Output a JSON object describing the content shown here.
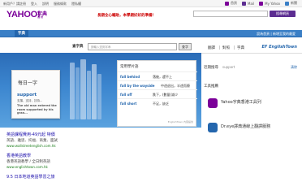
{
  "topbar": {
    "links": [
      "新用戶？請註冊",
      "登入",
      "說明",
      "服務條款",
      "隱私權"
    ],
    "right_items": [
      {
        "label": "首頁",
        "icon": "home-icon",
        "color": "#7b0099"
      },
      {
        "label": "Mail",
        "icon": "mail-icon",
        "color": "#5c2d91"
      },
      {
        "label": "My Yahoo",
        "icon": "yahoo-icon",
        "color": "#7b0099"
      },
      {
        "label": "新聞",
        "icon": "news-icon",
        "color": "#3a7fc6"
      }
    ]
  },
  "header": {
    "logo": "YAHOO!",
    "product": "字典",
    "product_sub": "香港",
    "promo": "長期全心輔助，本學期好好的準備！",
    "search_button": "搜尋網頁",
    "accent": "#7b0099"
  },
  "tabbar": {
    "active_tab": "字典",
    "right_link": "設為首頁 | 新增至我的最愛"
  },
  "search": {
    "label": "查字典",
    "placeholder": "請輸入查詢字串",
    "button": "查字"
  },
  "translate_bar": {
    "items": [
      "翻譯",
      "對照",
      "字典"
    ],
    "brand": "EF EnglishTown"
  },
  "word_of_day": {
    "title": "每日一字",
    "word": "support",
    "meaning": "支撐，支持，扶持...",
    "example": "The old man entered the room supported by his gran..."
  },
  "phrases": {
    "title": "常用學片語",
    "rows": [
      {
        "en": "fall behind",
        "zh": "落後，趕不上"
      },
      {
        "en": "fall by the wayside",
        "zh": "中途退出，半途而廢"
      },
      {
        "en": "fall off",
        "zh": "跌下，(數量)減少"
      },
      {
        "en": "fall short",
        "zh": "不足，缺乏"
      }
    ],
    "credit": "EnglishTown 內容提供"
  },
  "recent": {
    "label": "近期搜尋",
    "value": "support",
    "link": "清除"
  },
  "tools": {
    "title": "工具推薦",
    "items": [
      {
        "name": "Yahoo字典香港工具列",
        "sub": "",
        "icon": "yahoo-tool-icon",
        "color": "#7b0099"
      },
      {
        "name": "Dr.eye譯典通線上翻譯服務",
        "sub": "",
        "icon": "dreye-icon",
        "color": "#2466ad"
      }
    ]
  },
  "ads": [
    {
      "title": "英語課程費用-49元起 特價",
      "desc": "英語、雅思、托福、商業、面試",
      "url": "www.wallstreetenglish.com.hk"
    },
    {
      "title": "香港英語教學",
      "desc": "香港英語教學 / 全日制英語",
      "url": "www.englishtown.com.hk"
    },
    {
      "title": "9.5 日本地道英語學習之旅",
      "desc": "",
      "url": ""
    }
  ]
}
